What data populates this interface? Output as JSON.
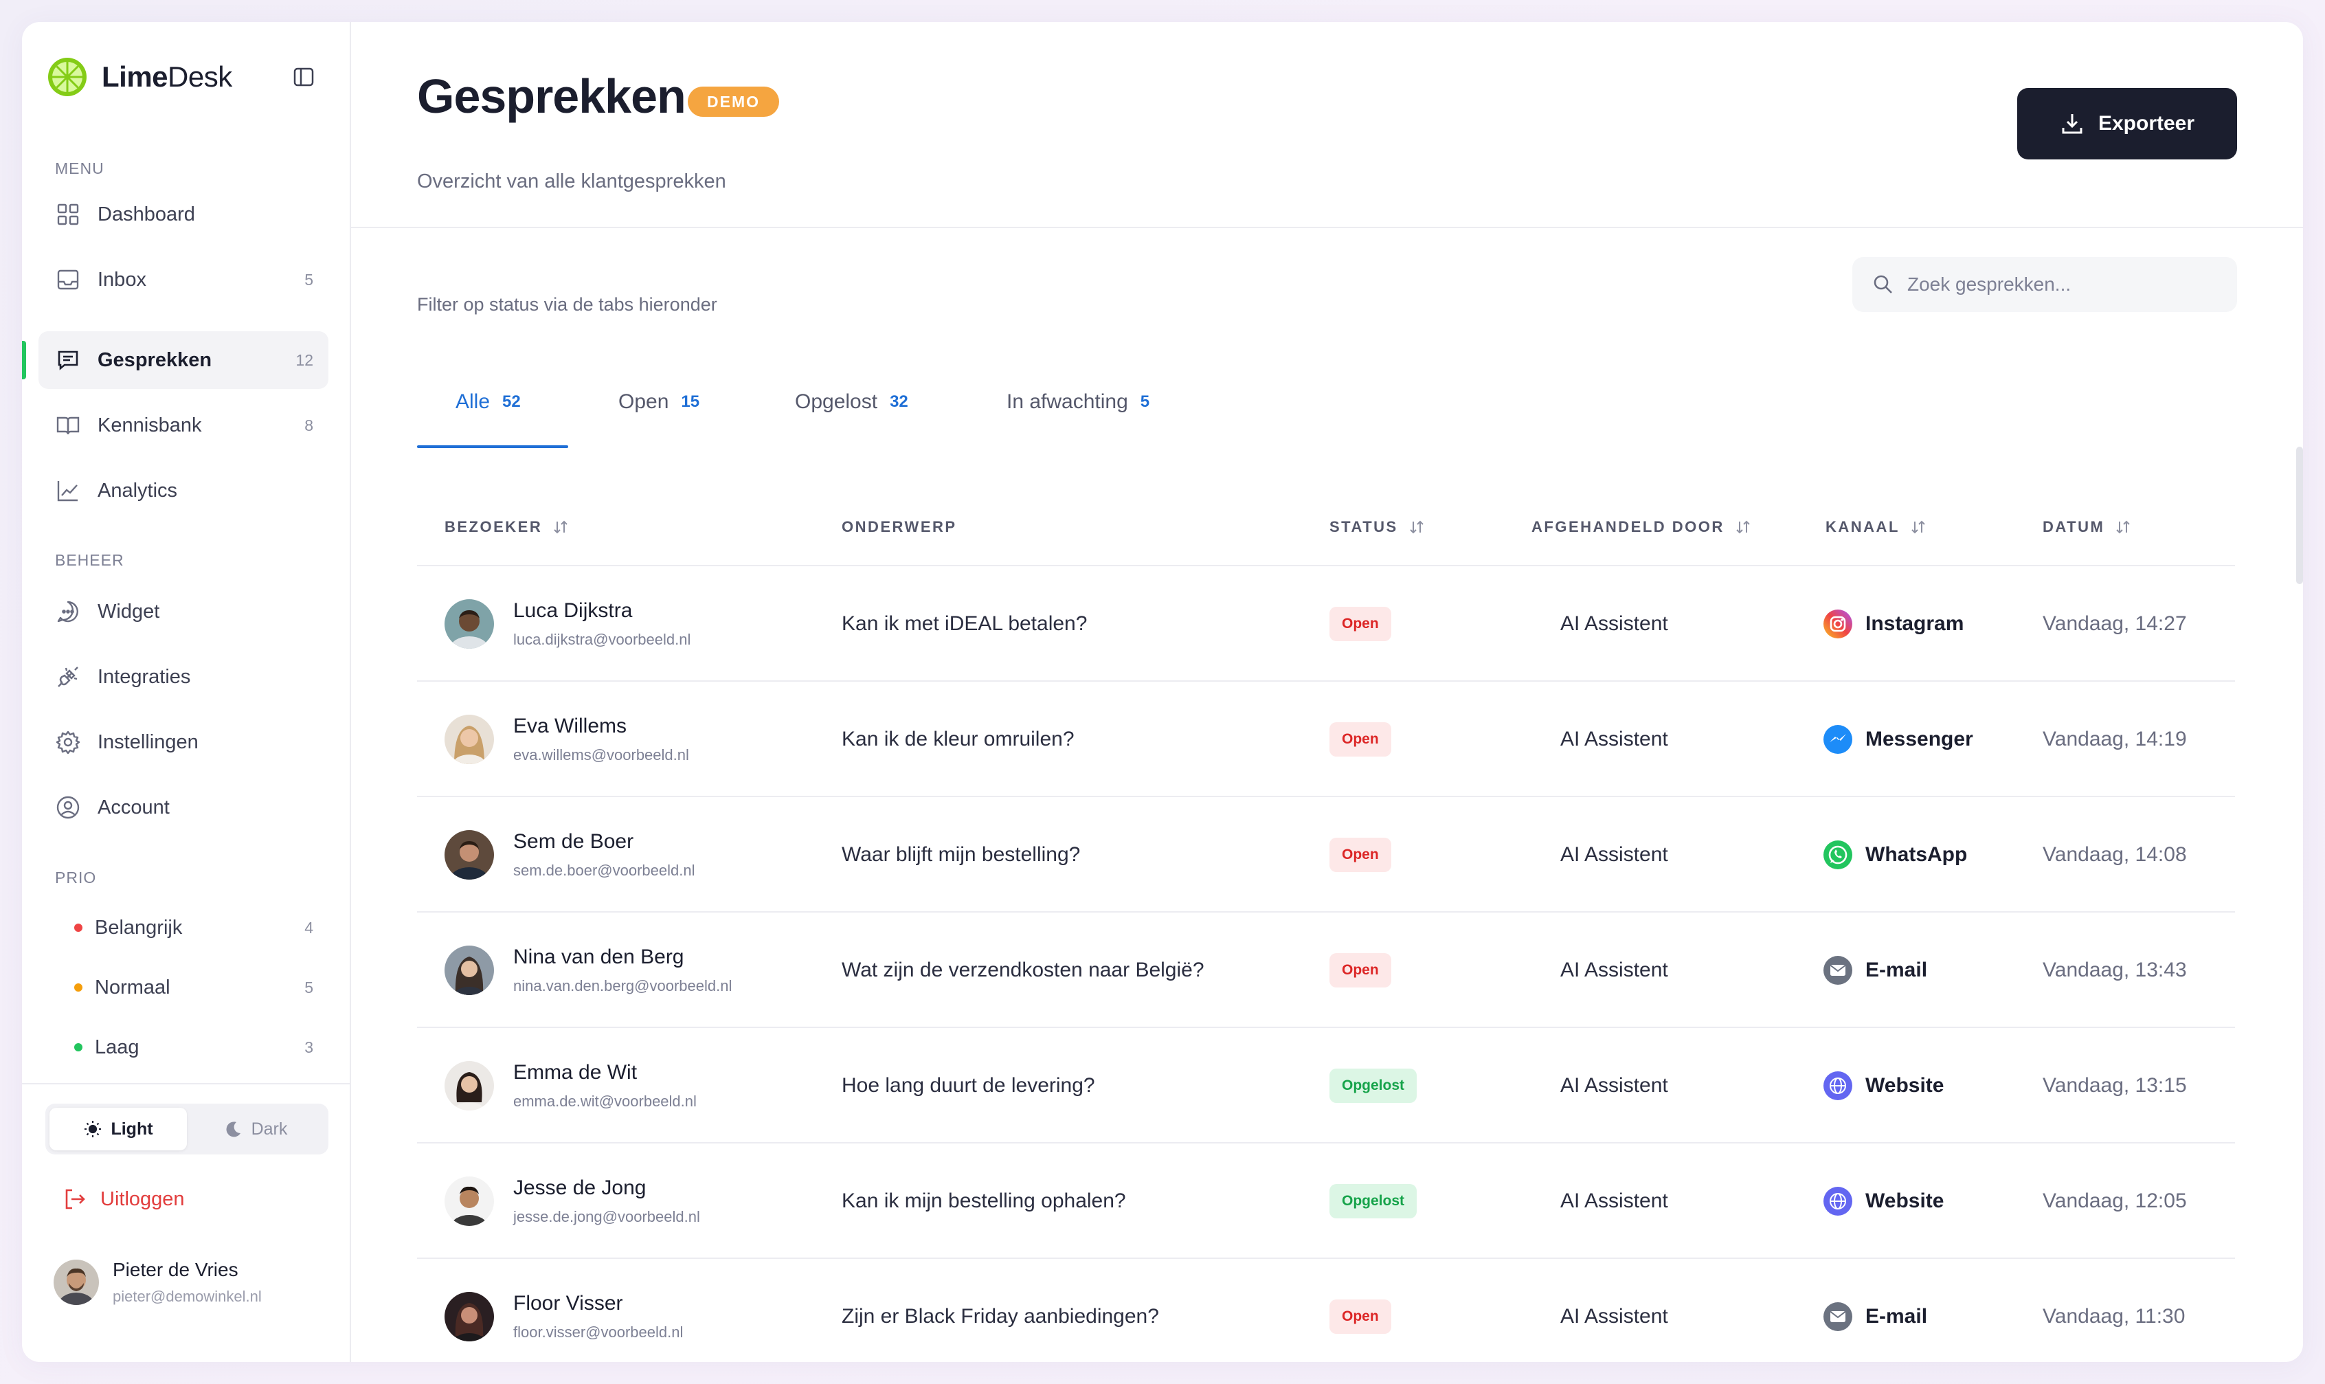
{
  "brand": {
    "name_bold": "Lime",
    "name_rest": "Desk"
  },
  "sidebar": {
    "menu_label": "MENU",
    "menu": [
      {
        "label": "Dashboard",
        "count": "",
        "icon": "dashboard-icon"
      },
      {
        "label": "Inbox",
        "count": "5",
        "icon": "inbox-icon"
      },
      {
        "label": "Gesprekken",
        "count": "12",
        "icon": "chat-icon"
      },
      {
        "label": "Kennisbank",
        "count": "8",
        "icon": "book-icon"
      },
      {
        "label": "Analytics",
        "count": "",
        "icon": "chart-icon"
      }
    ],
    "manage_label": "BEHEER",
    "manage": [
      {
        "label": "Widget",
        "icon": "widget-icon"
      },
      {
        "label": "Integraties",
        "icon": "plug-icon"
      },
      {
        "label": "Instellingen",
        "icon": "gear-icon"
      },
      {
        "label": "Account",
        "icon": "user-icon"
      }
    ],
    "prio_label": "PRIO",
    "prio": [
      {
        "label": "Belangrijk",
        "count": "4",
        "color": "#ef4444"
      },
      {
        "label": "Normaal",
        "count": "5",
        "color": "#f59e0b"
      },
      {
        "label": "Laag",
        "count": "3",
        "color": "#22c55e"
      }
    ],
    "theme": {
      "light": "Light",
      "dark": "Dark"
    },
    "logout": "Uitloggen",
    "user": {
      "name": "Pieter de Vries",
      "email": "pieter@demowinkel.nl"
    }
  },
  "header": {
    "title": "Gesprekken",
    "badge": "DEMO",
    "subtitle": "Overzicht van alle klantgesprekken",
    "export_label": "Exporteer"
  },
  "filter": {
    "hint": "Filter op status via de tabs hieronder",
    "search_placeholder": "Zoek gesprekken..."
  },
  "tabs": [
    {
      "label": "Alle",
      "count": "52"
    },
    {
      "label": "Open",
      "count": "15"
    },
    {
      "label": "Opgelost",
      "count": "32"
    },
    {
      "label": "In afwachting",
      "count": "5"
    }
  ],
  "table": {
    "columns": [
      "BEZOEKER",
      "ONDERWERP",
      "STATUS",
      "AFGEHANDELD DOOR",
      "KANAAL",
      "DATUM"
    ],
    "rows": [
      {
        "name": "Luca Dijkstra",
        "email": "luca.dijkstra@voorbeeld.nl",
        "subject": "Kan ik met iDEAL betalen?",
        "status": "Open",
        "handler": "AI Assistent",
        "channel": "Instagram",
        "date": "Vandaag, 14:27"
      },
      {
        "name": "Eva Willems",
        "email": "eva.willems@voorbeeld.nl",
        "subject": "Kan ik de kleur omruilen?",
        "status": "Open",
        "handler": "AI Assistent",
        "channel": "Messenger",
        "date": "Vandaag, 14:19"
      },
      {
        "name": "Sem de Boer",
        "email": "sem.de.boer@voorbeeld.nl",
        "subject": "Waar blijft mijn bestelling?",
        "status": "Open",
        "handler": "AI Assistent",
        "channel": "WhatsApp",
        "date": "Vandaag, 14:08"
      },
      {
        "name": "Nina van den Berg",
        "email": "nina.van.den.berg@voorbeeld.nl",
        "subject": "Wat zijn de verzendkosten naar België?",
        "status": "Open",
        "handler": "AI Assistent",
        "channel": "E-mail",
        "date": "Vandaag, 13:43"
      },
      {
        "name": "Emma de Wit",
        "email": "emma.de.wit@voorbeeld.nl",
        "subject": "Hoe lang duurt de levering?",
        "status": "Opgelost",
        "handler": "AI Assistent",
        "channel": "Website",
        "date": "Vandaag, 13:15"
      },
      {
        "name": "Jesse de Jong",
        "email": "jesse.de.jong@voorbeeld.nl",
        "subject": "Kan ik mijn bestelling ophalen?",
        "status": "Opgelost",
        "handler": "AI Assistent",
        "channel": "Website",
        "date": "Vandaag, 12:05"
      },
      {
        "name": "Floor Visser",
        "email": "floor.visser@voorbeeld.nl",
        "subject": "Zijn er Black Friday aanbiedingen?",
        "status": "Open",
        "handler": "AI Assistent",
        "channel": "E-mail",
        "date": "Vandaag, 11:30"
      }
    ]
  }
}
